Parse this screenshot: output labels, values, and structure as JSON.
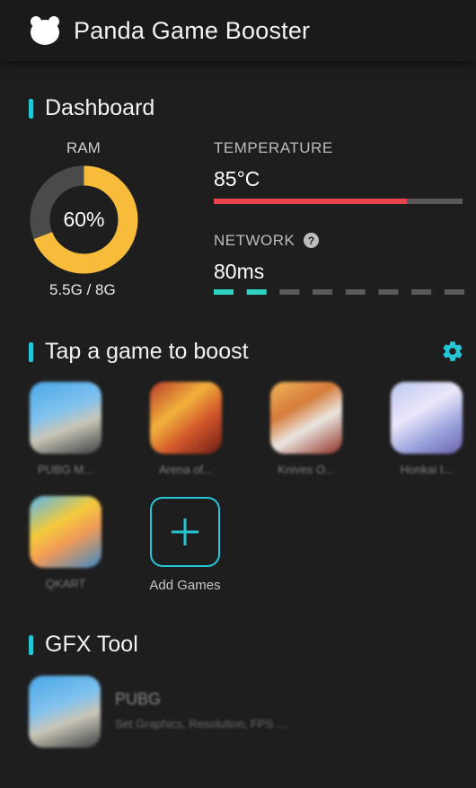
{
  "app": {
    "title": "Panda Game Booster",
    "icon": "panda-icon"
  },
  "dashboard": {
    "title": "Dashboard",
    "ram": {
      "label": "RAM",
      "percent_text": "60%",
      "used_fraction": 0.69,
      "usage": "5.5G / 8G"
    },
    "temperature": {
      "label": "TEMPERATURE",
      "value": "85°C",
      "bar_fraction": 0.776
    },
    "network": {
      "label": "NETWORK",
      "value": "80ms",
      "active_segments": 2,
      "total_segments": 8,
      "help_icon": "question-circle-icon"
    }
  },
  "games": {
    "title": "Tap a game to boost",
    "settings_icon": "gear-icon",
    "items": [
      {
        "name": "PUBG M...",
        "icon": "pubg-mobile-icon"
      },
      {
        "name": "Arena of...",
        "icon": "arena-of-valor-icon"
      },
      {
        "name": "Knives O...",
        "icon": "knives-out-icon"
      },
      {
        "name": "Honkai I...",
        "icon": "honkai-impact-icon"
      },
      {
        "name": "QKART",
        "icon": "qkart-icon"
      }
    ],
    "add_label": "Add Games"
  },
  "gfx": {
    "title": "GFX Tool",
    "item": {
      "title": "PUBG",
      "subtitle": "Set Graphics, Resolution, FPS ..."
    }
  },
  "colors": {
    "accent": "#25c6d8",
    "ram_used": "#f8bc3a",
    "ram_free": "#4a4a4a",
    "temperature_bar": "#e8434b",
    "network_active": "#2fd3c4"
  }
}
